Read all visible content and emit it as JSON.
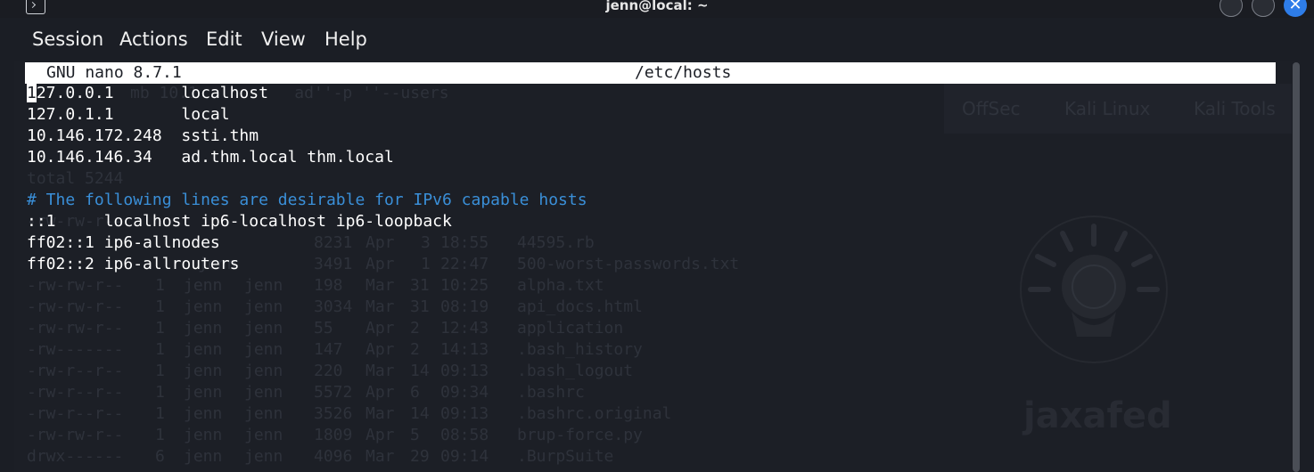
{
  "window": {
    "title": "jenn@local: ~",
    "icon": "terminal-icon",
    "close_glyph": "✕"
  },
  "menu": [
    "Session",
    "Actions",
    "Edit",
    "View",
    "Help"
  ],
  "nano": {
    "version": "GNU nano 8.7.1",
    "filename": "/etc/hosts",
    "cursor_char": "1",
    "first_line_rest": "27.0.0.1       localhost",
    "lines": [
      "127.0.1.1       local",
      "10.146.172.248  ssti.thm",
      "10.146.146.34   ad.thm.local thm.local"
    ],
    "comment": "# The following lines are desirable for IPv6 capable hosts",
    "ipv6": [
      "::1     localhost ip6-localhost ip6-loopback",
      "ff02::1 ip6-allnodes",
      "ff02::2 ip6-allrouters"
    ]
  },
  "background_listing": {
    "command_fragment": "mb 10.1          ad''-p ''--users",
    "total": "total 5244",
    "rows": [
      {
        "perms": "-rw-rw-r--",
        "links": "1",
        "owner": "jenn",
        "group": "jenn",
        "size": "8231",
        "month": "Apr",
        "day": "3",
        "time": "18:55",
        "name": "44595.rb"
      },
      {
        "perms": "-rw-rw-r--",
        "links": "1",
        "owner": "jenn",
        "group": "jenn",
        "size": "3491",
        "month": "Apr",
        "day": "1",
        "time": "22:47",
        "name": "500-worst-passwords.txt"
      },
      {
        "perms": "-rw-rw-r--",
        "links": "1",
        "owner": "jenn",
        "group": "jenn",
        "size": "198",
        "month": "Mar",
        "day": "31",
        "time": "10:25",
        "name": "alpha.txt"
      },
      {
        "perms": "-rw-rw-r--",
        "links": "1",
        "owner": "jenn",
        "group": "jenn",
        "size": "3034",
        "month": "Mar",
        "day": "31",
        "time": "08:19",
        "name": "api_docs.html"
      },
      {
        "perms": "-rw-rw-r--",
        "links": "1",
        "owner": "jenn",
        "group": "jenn",
        "size": "55",
        "month": "Apr",
        "day": "2",
        "time": "12:43",
        "name": "application"
      },
      {
        "perms": "-rw-------",
        "links": "1",
        "owner": "jenn",
        "group": "jenn",
        "size": "147",
        "month": "Apr",
        "day": "2",
        "time": "14:13",
        "name": ".bash_history"
      },
      {
        "perms": "-rw-r--r--",
        "links": "1",
        "owner": "jenn",
        "group": "jenn",
        "size": "220",
        "month": "Mar",
        "day": "14",
        "time": "09:13",
        "name": ".bash_logout"
      },
      {
        "perms": "-rw-r--r--",
        "links": "1",
        "owner": "jenn",
        "group": "jenn",
        "size": "5572",
        "month": "Apr",
        "day": "6",
        "time": "09:34",
        "name": ".bashrc"
      },
      {
        "perms": "-rw-r--r--",
        "links": "1",
        "owner": "jenn",
        "group": "jenn",
        "size": "3526",
        "month": "Mar",
        "day": "14",
        "time": "09:13",
        "name": ".bashrc.original"
      },
      {
        "perms": "-rw-rw-r--",
        "links": "1",
        "owner": "jenn",
        "group": "jenn",
        "size": "1809",
        "month": "Apr",
        "day": "5",
        "time": "08:58",
        "name": "brup-force.py"
      },
      {
        "perms": "drwx------",
        "links": "6",
        "owner": "jenn",
        "group": "jenn",
        "size": "4096",
        "month": "Mar",
        "day": "29",
        "time": "09:14",
        "name": ".BurpSuite"
      }
    ]
  },
  "desktop_links": [
    "OffSec",
    "Kali Linux",
    "Kali Tools"
  ],
  "watermark": "jaxafed"
}
